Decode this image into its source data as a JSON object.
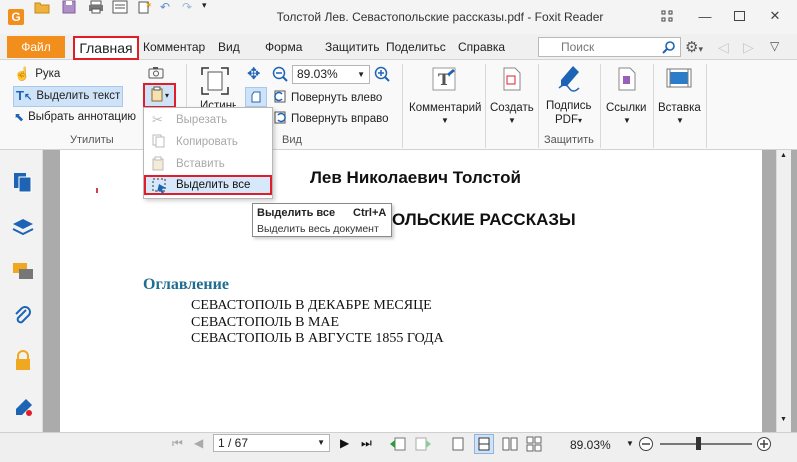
{
  "window": {
    "title": "Толстой Лев. Севастопольские рассказы.pdf - Foxit Reader"
  },
  "menu": {
    "file": "Файл",
    "home": "Главная",
    "comment": "Комментар",
    "view": "Вид",
    "form": "Форма",
    "protect": "Защитить",
    "share": "Поделиться",
    "help": "Справка"
  },
  "search": {
    "placeholder": "Поиск"
  },
  "ribbon": {
    "hand": "Рука",
    "select_text": "Выделить текст",
    "select_annotation": "Выбрать аннотацию",
    "group_tools": "Утилиты",
    "actual_size": "Истинный",
    "zoom_value": "89.03%",
    "rotate_left": "Повернуть влево",
    "rotate_right": "Повернуть вправо",
    "group_view": "Вид",
    "comment": "Комментарий",
    "create": "Создать",
    "sign_line1": "Подпись",
    "sign_line2": "PDF",
    "group_protect": "Защитить",
    "links": "Ссылки",
    "insert": "Вставка"
  },
  "dropdown": {
    "cut": "Вырезать",
    "copy": "Копировать",
    "paste": "Вставить",
    "select_all": "Выделить все"
  },
  "tooltip": {
    "title": "Выделить все",
    "shortcut": "Ctrl+A",
    "description": "Выделить весь документ"
  },
  "document": {
    "author": "Лев Николаевич Толстой",
    "title_visible": "ОЛЬСКИЕ РАССКАЗЫ",
    "toc_heading": "Оглавление",
    "entries": [
      "СЕВАСТОПОЛЬ В ДЕКАБРЕ МЕСЯЦЕ",
      "СЕВАСТОПОЛЬ В МАЕ",
      "СЕВАСТОПОЛЬ В АВГУСТЕ 1855 ГОДА"
    ]
  },
  "status": {
    "page": "1 / 67",
    "zoom": "89.03%"
  },
  "colors": {
    "accent_orange": "#f28f1c",
    "highlight_red": "#e01e2a",
    "toc_blue": "#1f6d8f",
    "icon_blue": "#1e64b4"
  }
}
